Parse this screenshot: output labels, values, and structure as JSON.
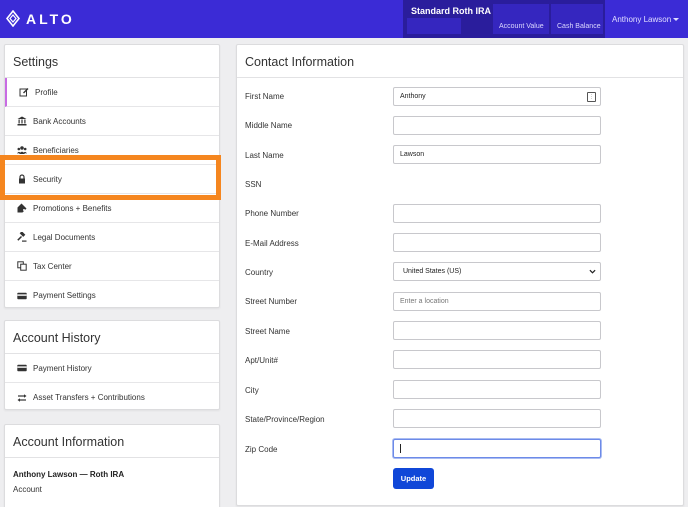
{
  "brand": {
    "name": "ALTO"
  },
  "header": {
    "account_name": "Standard Roth IRA",
    "account_value_label": "Account Value",
    "cash_balance_label": "Cash Balance",
    "user_name": "Anthony Lawson"
  },
  "settings": {
    "title": "Settings",
    "items": [
      {
        "label": "Profile",
        "icon": "edit-icon"
      },
      {
        "label": "Bank Accounts",
        "icon": "bank-icon"
      },
      {
        "label": "Beneficiaries",
        "icon": "users-icon"
      },
      {
        "label": "Security",
        "icon": "lock-icon"
      },
      {
        "label": "Promotions + Benefits",
        "icon": "tag-icon"
      },
      {
        "label": "Legal Documents",
        "icon": "gavel-icon"
      },
      {
        "label": "Tax Center",
        "icon": "copy-icon"
      },
      {
        "label": "Payment Settings",
        "icon": "credit-card-icon"
      }
    ]
  },
  "account_history": {
    "title": "Account History",
    "items": [
      {
        "label": "Payment History",
        "icon": "credit-card-icon"
      },
      {
        "label": "Asset Transfers + Contributions",
        "icon": "exchange-icon"
      }
    ]
  },
  "account_information": {
    "title": "Account Information",
    "name": "Anthony Lawson — Roth IRA",
    "sub": "Account"
  },
  "contact": {
    "title": "Contact Information",
    "first_name_label": "First Name",
    "first_name_value": "Anthony",
    "middle_name_label": "Middle Name",
    "middle_name_value": "",
    "last_name_label": "Last Name",
    "last_name_value": "Lawson",
    "ssn_label": "SSN",
    "phone_label": "Phone Number",
    "email_label": "E-Mail Address",
    "country_label": "Country",
    "country_value": "United States (US)",
    "street_number_label": "Street Number",
    "street_number_placeholder": "Enter a location",
    "street_name_label": "Street Name",
    "apt_label": "Apt/Unit#",
    "city_label": "City",
    "state_label": "State/Province/Region",
    "zip_label": "Zip Code",
    "update_label": "Update"
  },
  "colors": {
    "topbar": "#3b2bd6",
    "account_block": "#2a1d9c",
    "highlight": "#f5861f",
    "active_marker": "#c86be3",
    "primary_button": "#1047d8"
  }
}
